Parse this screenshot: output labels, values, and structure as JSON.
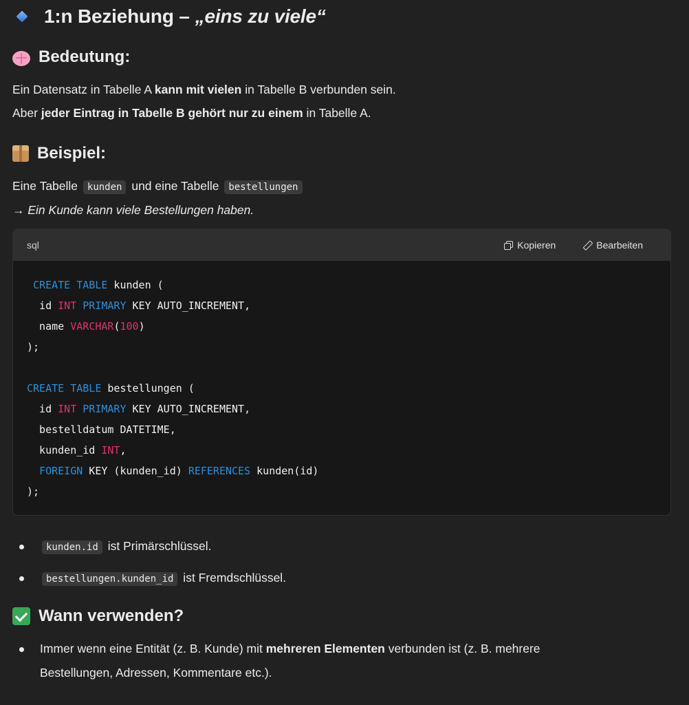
{
  "heading": {
    "prefix": "1:n Beziehung – ",
    "italic": "„eins zu viele“"
  },
  "bedeutung": {
    "title": "Bedeutung:",
    "line1": {
      "a": "Ein Datensatz in Tabelle A ",
      "b": "kann mit vielen",
      "c": " in Tabelle B verbunden sein."
    },
    "line2": {
      "a": "Aber ",
      "b": "jeder Eintrag in Tabelle B gehört nur zu einem",
      "c": " in Tabelle A."
    }
  },
  "beispiel": {
    "title": "Beispiel:",
    "line1": {
      "a": "Eine Tabelle ",
      "code1": "kunden",
      "b": " und eine Tabelle ",
      "code2": "bestellungen"
    },
    "line2": "→ Ein Kunde kann viele Bestellungen haben."
  },
  "codeblock": {
    "language": "sql",
    "copy_label": "Kopieren",
    "edit_label": "Bearbeiten",
    "lines": [
      " CREATE TABLE kunden (",
      "  id INT PRIMARY KEY AUTO_INCREMENT,",
      "  name VARCHAR(100)",
      ");",
      "",
      "CREATE TABLE bestellungen (",
      "  id INT PRIMARY KEY AUTO_INCREMENT,",
      "  bestelldatum DATETIME,",
      "  kunden_id INT,",
      "  FOREIGN KEY (kunden_id) REFERENCES kunden(id)",
      ");"
    ]
  },
  "keys": [
    {
      "code": "kunden.id",
      "text": " ist Primärschlüssel."
    },
    {
      "code": "bestellungen.kunden_id",
      "text": " ist Fremdschlüssel."
    }
  ],
  "wann": {
    "title": "Wann verwenden?",
    "item": {
      "a": "Immer wenn eine Entität (z. B. Kunde) mit ",
      "b": "mehreren Elementen",
      "c": " verbunden ist (z. B. mehrere",
      "d": "Bestellungen, Adressen, Kommentare etc.)."
    }
  },
  "colors": {
    "background": "#212121",
    "code_background": "#171717",
    "keyword": "#2f8fd9",
    "type": "#e0326b"
  }
}
